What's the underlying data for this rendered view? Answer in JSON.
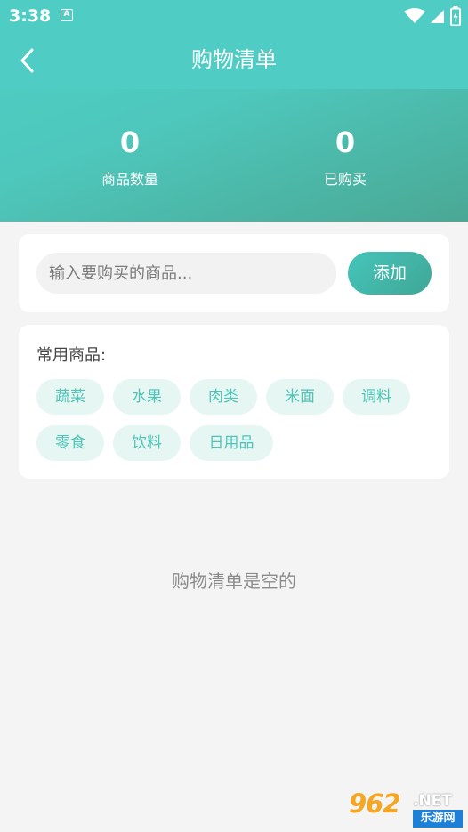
{
  "status_bar": {
    "time": "3:38",
    "notification_glyph": "A",
    "icons": [
      "wifi-icon",
      "signal-icon",
      "battery-icon"
    ]
  },
  "nav": {
    "title": "购物清单",
    "back_icon": "chevron-left-icon"
  },
  "stats": [
    {
      "value": "0",
      "label": "商品数量"
    },
    {
      "value": "0",
      "label": "已购买"
    }
  ],
  "add_form": {
    "placeholder": "输入要购买的商品...",
    "value": "",
    "button_label": "添加"
  },
  "common_items": {
    "title": "常用商品:",
    "chips": [
      "蔬菜",
      "水果",
      "肉类",
      "米面",
      "调料",
      "零食",
      "饮料",
      "日用品"
    ]
  },
  "empty_state": "购物清单是空的",
  "watermark": {
    "number": "962",
    "suffix": ".NET",
    "caption": "乐游网"
  },
  "colors": {
    "header": "#4fcdc4",
    "accent": "#45c5ba",
    "chip_bg": "#e6f6f3",
    "chip_text": "#4ec4b8",
    "page_bg": "#f4f4f4"
  }
}
